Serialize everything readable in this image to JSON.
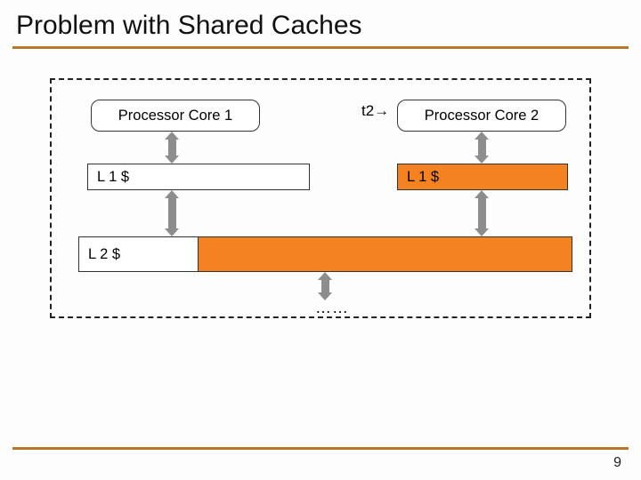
{
  "title": "Problem with Shared Caches",
  "annotation": "t2→",
  "core1": "Processor Core 1",
  "core2": "Processor Core 2",
  "l1_left": "L 1 $",
  "l1_right": "L 1 $",
  "l2": "L 2 $",
  "ellipsis": "……",
  "page": "9",
  "colors": {
    "accent": "#b8762a",
    "highlight": "#f58220"
  }
}
